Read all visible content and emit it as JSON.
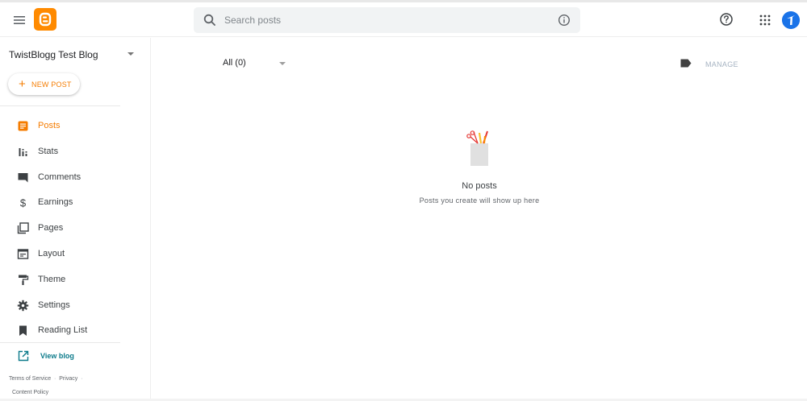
{
  "header": {
    "search_placeholder": "Search posts"
  },
  "sidebar": {
    "blog_name": "TwistBlogg Test Blog",
    "new_post_label": "NEW POST",
    "items": [
      {
        "label": "Posts",
        "icon": "posts-icon",
        "active": true
      },
      {
        "label": "Stats",
        "icon": "stats-icon"
      },
      {
        "label": "Comments",
        "icon": "comments-icon"
      },
      {
        "label": "Earnings",
        "icon": "dollar-icon"
      },
      {
        "label": "Pages",
        "icon": "pages-icon"
      },
      {
        "label": "Layout",
        "icon": "layout-icon"
      },
      {
        "label": "Theme",
        "icon": "paint-roller-icon"
      },
      {
        "label": "Settings",
        "icon": "gear-icon"
      },
      {
        "label": "Reading List",
        "icon": "bookmark-icon"
      }
    ],
    "view_blog_label": "View blog",
    "footer": {
      "terms": "Terms of Service",
      "privacy": "Privacy",
      "content_policy": "Content Policy"
    }
  },
  "main": {
    "filter_label": "All (0)",
    "manage_label": "MANAGE",
    "empty_title": "No posts",
    "empty_subtitle": "Posts you create will show up here"
  },
  "colors": {
    "accent": "#f57c00",
    "link": "#0b7a8a",
    "avatar": "#1a73e8"
  }
}
